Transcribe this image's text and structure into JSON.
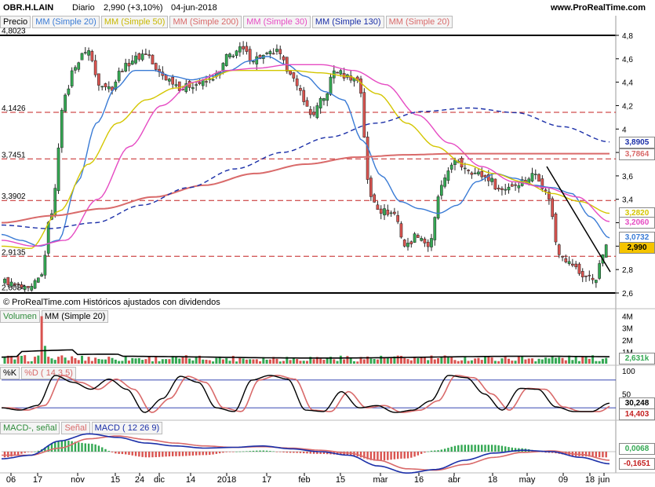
{
  "header": {
    "symbol": "OBR.H.LAIN",
    "period": "Diario",
    "last": "2,990 (+3,10%)",
    "date": "04-jun-2018",
    "site": "www.ProRealTime.com"
  },
  "legends": {
    "price": [
      "Precio",
      "MM (Simple 20)",
      "MM (Simple 50)",
      "MM (Simple 200)",
      "MM (Simple 30)",
      "MM (Simple 130)",
      "MM (Simple 20)"
    ],
    "volume": [
      "Volumen",
      "MM (Simple 20)"
    ],
    "stoch": [
      "%K",
      "%D ( 14 3 5)"
    ],
    "macd": [
      "MACD-, señal",
      "Señal",
      "MACD ( 12 26 9)"
    ]
  },
  "credit": "© ProRealTime.com  Históricos ajustados con dividendos",
  "colors": {
    "up": "#34a853",
    "down": "#d9534f",
    "ma20": "#3a7bd5",
    "ma50": "#d4c600",
    "ma200": "#d96a6a",
    "ma30": "#e64bc3",
    "ma130": "#1b2fa8",
    "support": "#c42020",
    "trend": "#000000"
  },
  "chart_data": [
    {
      "type": "candlestick",
      "title": "OBR.H.LAIN Diario",
      "ylim": [
        2.6,
        4.8
      ],
      "y_ticks": [
        "4,8",
        "4,6",
        "4,4",
        "4,2",
        "4",
        "3,8",
        "3,6",
        "3,4",
        "3,2",
        "3",
        "2,8",
        "2,6"
      ],
      "x_ticks": [
        "06",
        "17",
        "nov",
        "15",
        "24",
        "dic",
        "14",
        "2018",
        "17",
        "feb",
        "15",
        "mar",
        "16",
        "abr",
        "18",
        "may",
        "09",
        "18",
        "jun"
      ],
      "levels": [
        {
          "label": "4,8023",
          "value": 4.8023
        },
        {
          "label": "4,1426",
          "value": 4.1426
        },
        {
          "label": "3,7451",
          "value": 3.7451
        },
        {
          "label": "3,3902",
          "value": 3.3902
        },
        {
          "label": "2,9135",
          "value": 2.9135
        },
        {
          "label": "2,6084",
          "value": 2.6084
        }
      ],
      "right_labels": [
        {
          "text": "3,8905",
          "value": 3.8905,
          "series": "MM (Simple 130)"
        },
        {
          "text": "3,7864",
          "value": 3.7864,
          "series": "MM (Simple 200)"
        },
        {
          "text": "3,2820",
          "value": 3.282,
          "series": "MM (Simple 50)"
        },
        {
          "text": "3,2060",
          "value": 3.206,
          "series": "MM (Simple 30)"
        },
        {
          "text": "3,0732",
          "value": 3.0732,
          "series": "MM (Simple 20)"
        },
        {
          "text": "2,990",
          "value": 2.99,
          "series": "Precio"
        }
      ],
      "close_anchors": [
        2.7,
        2.66,
        2.62,
        2.72,
        3.3,
        4.25,
        4.55,
        4.68,
        4.4,
        4.35,
        4.52,
        4.6,
        4.65,
        4.48,
        4.42,
        4.35,
        4.38,
        4.4,
        4.46,
        4.63,
        4.68,
        4.6,
        4.62,
        4.66,
        4.52,
        4.32,
        4.12,
        4.25,
        4.5,
        4.45,
        4.42,
        3.42,
        3.3,
        3.28,
        3.0,
        3.1,
        3.0,
        3.5,
        3.72,
        3.68,
        3.62,
        3.58,
        3.48,
        3.52,
        3.56,
        3.62,
        3.45,
        2.95,
        2.85,
        2.75,
        2.72,
        2.99
      ],
      "ma_anchors": {
        "MM (Simple 20)": [
          3.1,
          3.05,
          3.0,
          3.05,
          3.55,
          4.05,
          4.35,
          4.5,
          4.5,
          4.45,
          4.42,
          4.45,
          4.5,
          4.58,
          4.62,
          4.55,
          4.45,
          4.32,
          4.25,
          3.9,
          3.6,
          3.38,
          3.32,
          3.28,
          3.35,
          3.55,
          3.62,
          3.58,
          3.52,
          3.5,
          3.45,
          3.25,
          3.07
        ],
        "MM (Simple 50)": [
          3.0,
          2.98,
          3.3,
          3.7,
          4.05,
          4.25,
          4.35,
          4.42,
          4.5,
          4.5,
          4.5,
          4.48,
          4.45,
          4.3,
          4.05,
          3.85,
          3.7,
          3.62,
          3.55,
          3.45,
          3.38,
          3.28
        ],
        "MM (Simple 30)": [
          3.05,
          3.0,
          3.05,
          3.4,
          3.85,
          4.2,
          4.4,
          4.5,
          4.52,
          4.55,
          4.55,
          4.5,
          4.38,
          4.12,
          3.88,
          3.68,
          3.55,
          3.5,
          3.42,
          3.21
        ],
        "MM (Simple 200)": [
          3.2,
          3.26,
          3.32,
          3.42,
          3.52,
          3.62,
          3.7,
          3.76,
          3.78,
          3.79,
          3.79,
          3.79,
          3.79
        ],
        "MM (Simple 130)": [
          3.18,
          3.15,
          3.2,
          3.35,
          3.5,
          3.66,
          3.8,
          3.93,
          4.05,
          4.15,
          4.18,
          4.14,
          4.02,
          3.89
        ]
      }
    },
    {
      "type": "bar",
      "title": "Volumen",
      "y_ticks": [
        "4M",
        "3M",
        "2M",
        "1M"
      ],
      "last_label": "2,631k",
      "spikes": [
        {
          "position": 0.06,
          "value": 4.0
        },
        {
          "position": 0.065,
          "value": 1.5
        },
        {
          "position": 0.92,
          "value": 0.55
        }
      ],
      "base_level": 0.6
    },
    {
      "type": "line",
      "title": "%K / %D ( 14 3 5)",
      "ylim": [
        0,
        100
      ],
      "y_ticks": [
        "100",
        "50",
        "0"
      ],
      "levels": [
        80,
        20
      ],
      "right_labels": [
        {
          "text": "30,248",
          "value": 30.248
        },
        {
          "text": "14,403",
          "value": 14.403
        }
      ],
      "peaks_k": [
        20,
        15,
        25,
        90,
        75,
        60,
        82,
        60,
        10,
        40,
        88,
        75,
        20,
        12,
        80,
        90,
        82,
        15,
        12,
        55,
        20,
        25,
        10,
        15,
        35,
        90,
        85,
        50,
        15,
        62,
        60,
        22,
        12,
        12,
        30
      ]
    },
    {
      "type": "bar",
      "title": "MACD ( 12 26 9)",
      "right_labels": [
        {
          "text": "0,0068",
          "value": 0.0068
        },
        {
          "text": "-0,1651",
          "value": -0.1651
        }
      ],
      "macd": [
        -0.1,
        -0.05,
        0.15,
        0.25,
        0.2,
        0.12,
        0.08,
        0.05,
        0.06,
        0.08,
        0.04,
        0.0,
        -0.05,
        -0.2,
        -0.3,
        -0.25,
        -0.12,
        -0.02,
        0.02,
        0.0,
        -0.08,
        -0.17
      ],
      "signal": [
        -0.05,
        -0.05,
        0.05,
        0.18,
        0.22,
        0.17,
        0.12,
        0.08,
        0.06,
        0.07,
        0.05,
        0.02,
        -0.02,
        -0.12,
        -0.24,
        -0.26,
        -0.18,
        -0.08,
        -0.01,
        0.01,
        -0.04,
        -0.12
      ]
    }
  ]
}
